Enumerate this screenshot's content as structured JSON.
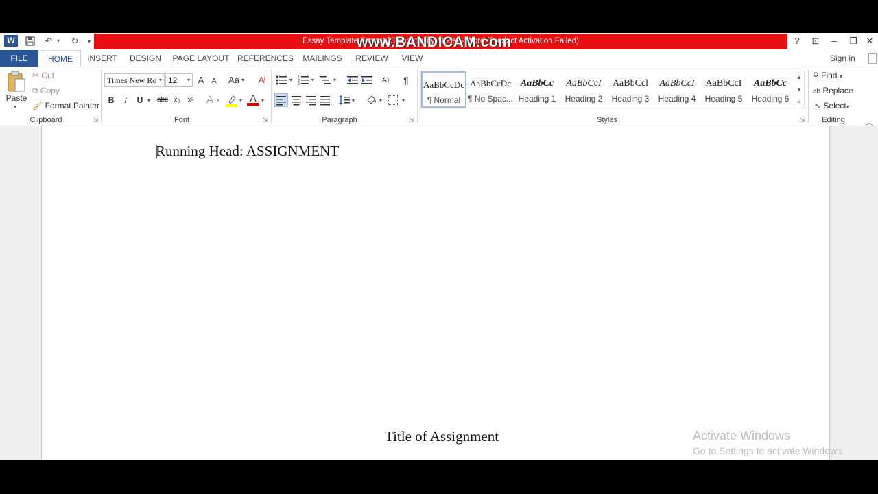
{
  "window": {
    "title": "Essay Template Format [Compatibility Mode] - Word (Product Activation Failed)",
    "watermark": "www.BANDICAM.com",
    "accent_title_color": "#e81010",
    "help": "?",
    "ribbon_display": "⊡",
    "minimize": "–",
    "restore": "❐",
    "close": "✕"
  },
  "quick_access": {
    "app_icon": "W",
    "save": "💾",
    "undo": "↶",
    "redo": "↻",
    "customize": "▾"
  },
  "tabs": [
    "FILE",
    "HOME",
    "INSERT",
    "DESIGN",
    "PAGE LAYOUT",
    "REFERENCES",
    "MAILINGS",
    "REVIEW",
    "VIEW"
  ],
  "sign_in": "Sign in",
  "clipboard": {
    "paste": "Paste",
    "cut": "Cut",
    "copy": "Copy",
    "format_painter": "Format Painter",
    "label": "Clipboard"
  },
  "font": {
    "name": "Times New Ro",
    "size": "12",
    "grow": "A",
    "shrink": "A",
    "change_case": "Aa",
    "bold": "B",
    "italic": "I",
    "underline": "U",
    "strikethrough": "abc",
    "subscript": "x₂",
    "superscript": "x²",
    "text_effects": "A",
    "font_color": "A",
    "label": "Font"
  },
  "paragraph": {
    "label": "Paragraph",
    "sort": "A↓",
    "show_marks": "¶"
  },
  "styles": {
    "label": "Styles",
    "items": [
      {
        "preview": "AaBbCcDc",
        "name": "¶ Normal"
      },
      {
        "preview": "AaBbCcDc",
        "name": "¶ No Spac..."
      },
      {
        "preview": "AaBbCc",
        "name": "Heading 1"
      },
      {
        "preview": "AaBbCcI",
        "name": "Heading 2"
      },
      {
        "preview": "AaBbCcl",
        "name": "Heading 3"
      },
      {
        "preview": "AaBbCcI",
        "name": "Heading 4"
      },
      {
        "preview": "AaBbCcI",
        "name": "Heading 5"
      },
      {
        "preview": "AaBbCc",
        "name": "Heading 6"
      }
    ]
  },
  "editing": {
    "find": "Find",
    "replace": "Replace",
    "select": "Select",
    "label": "Editing"
  },
  "document": {
    "running_head": "Running Head: ASSIGNMENT",
    "title": "Title of Assignment"
  },
  "activation": {
    "line1": "Activate Windows",
    "line2": "Go to Settings to activate Windows."
  }
}
